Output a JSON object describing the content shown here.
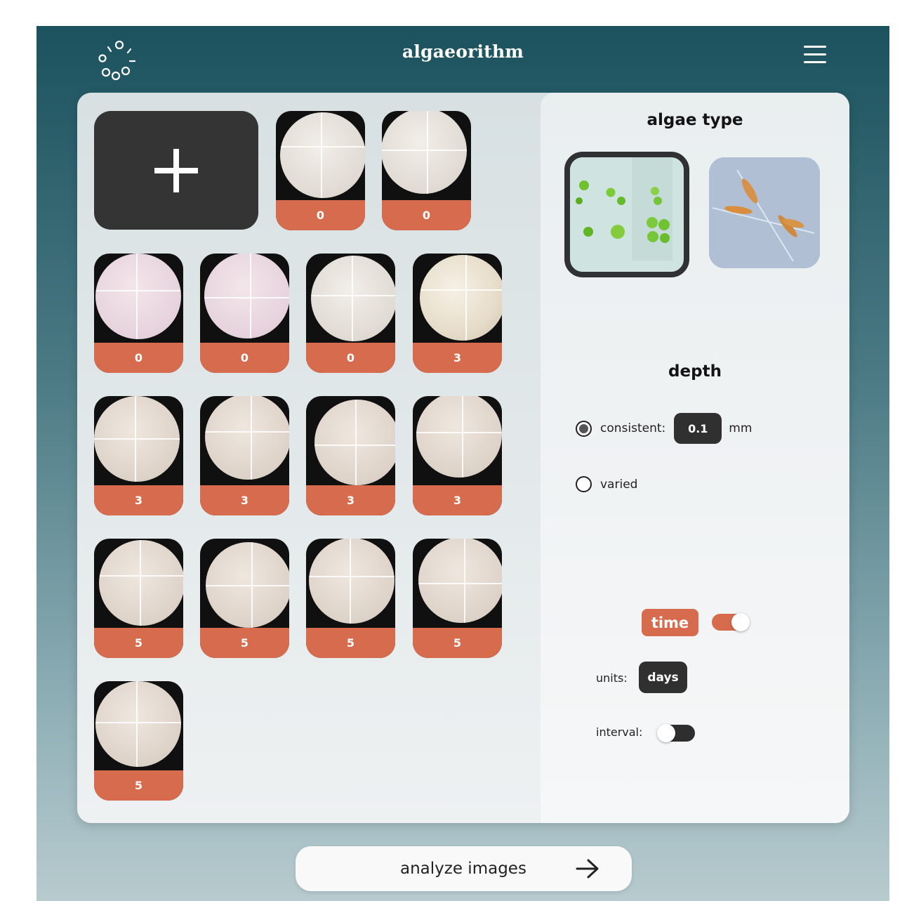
{
  "header": {
    "app_title": "algaeorithm",
    "logo_icon": "loading-dots-logo-icon",
    "menu_icon": "hamburger-menu-icon"
  },
  "gallery": {
    "add_icon": "plus-icon",
    "images": [
      {
        "count": "0",
        "style": "light"
      },
      {
        "count": "0",
        "style": "light"
      },
      {
        "count": "0",
        "style": "pink"
      },
      {
        "count": "0",
        "style": "pink"
      },
      {
        "count": "0",
        "style": "light"
      },
      {
        "count": "3",
        "style": "glow"
      },
      {
        "count": "3",
        "style": "beige"
      },
      {
        "count": "3",
        "style": "beige"
      },
      {
        "count": "3",
        "style": "beige"
      },
      {
        "count": "3",
        "style": "beige"
      },
      {
        "count": "5",
        "style": "beige"
      },
      {
        "count": "5",
        "style": "beige"
      },
      {
        "count": "5",
        "style": "beige"
      },
      {
        "count": "5",
        "style": "beige"
      },
      {
        "count": "5",
        "style": "beige"
      }
    ]
  },
  "settings": {
    "algae_type_title": "algae type",
    "algae_options": [
      {
        "name": "green-algae-chlorella",
        "selected": true
      },
      {
        "name": "diatom-algae",
        "selected": false
      }
    ],
    "depth_title": "depth",
    "depth_consistent_label": "consistent:",
    "depth_value": "0.1",
    "depth_unit": "mm",
    "depth_varied_label": "varied",
    "depth_mode": "consistent",
    "time_label": "time",
    "time_enabled": true,
    "units_label": "units:",
    "units_value": "days",
    "interval_label": "interval:",
    "interval_enabled": false
  },
  "actions": {
    "analyze_label": "analyze images",
    "analyze_icon": "arrow-right-icon"
  },
  "colors": {
    "accent": "#d76b4e",
    "dark": "#303030",
    "header": "#1b525e"
  }
}
